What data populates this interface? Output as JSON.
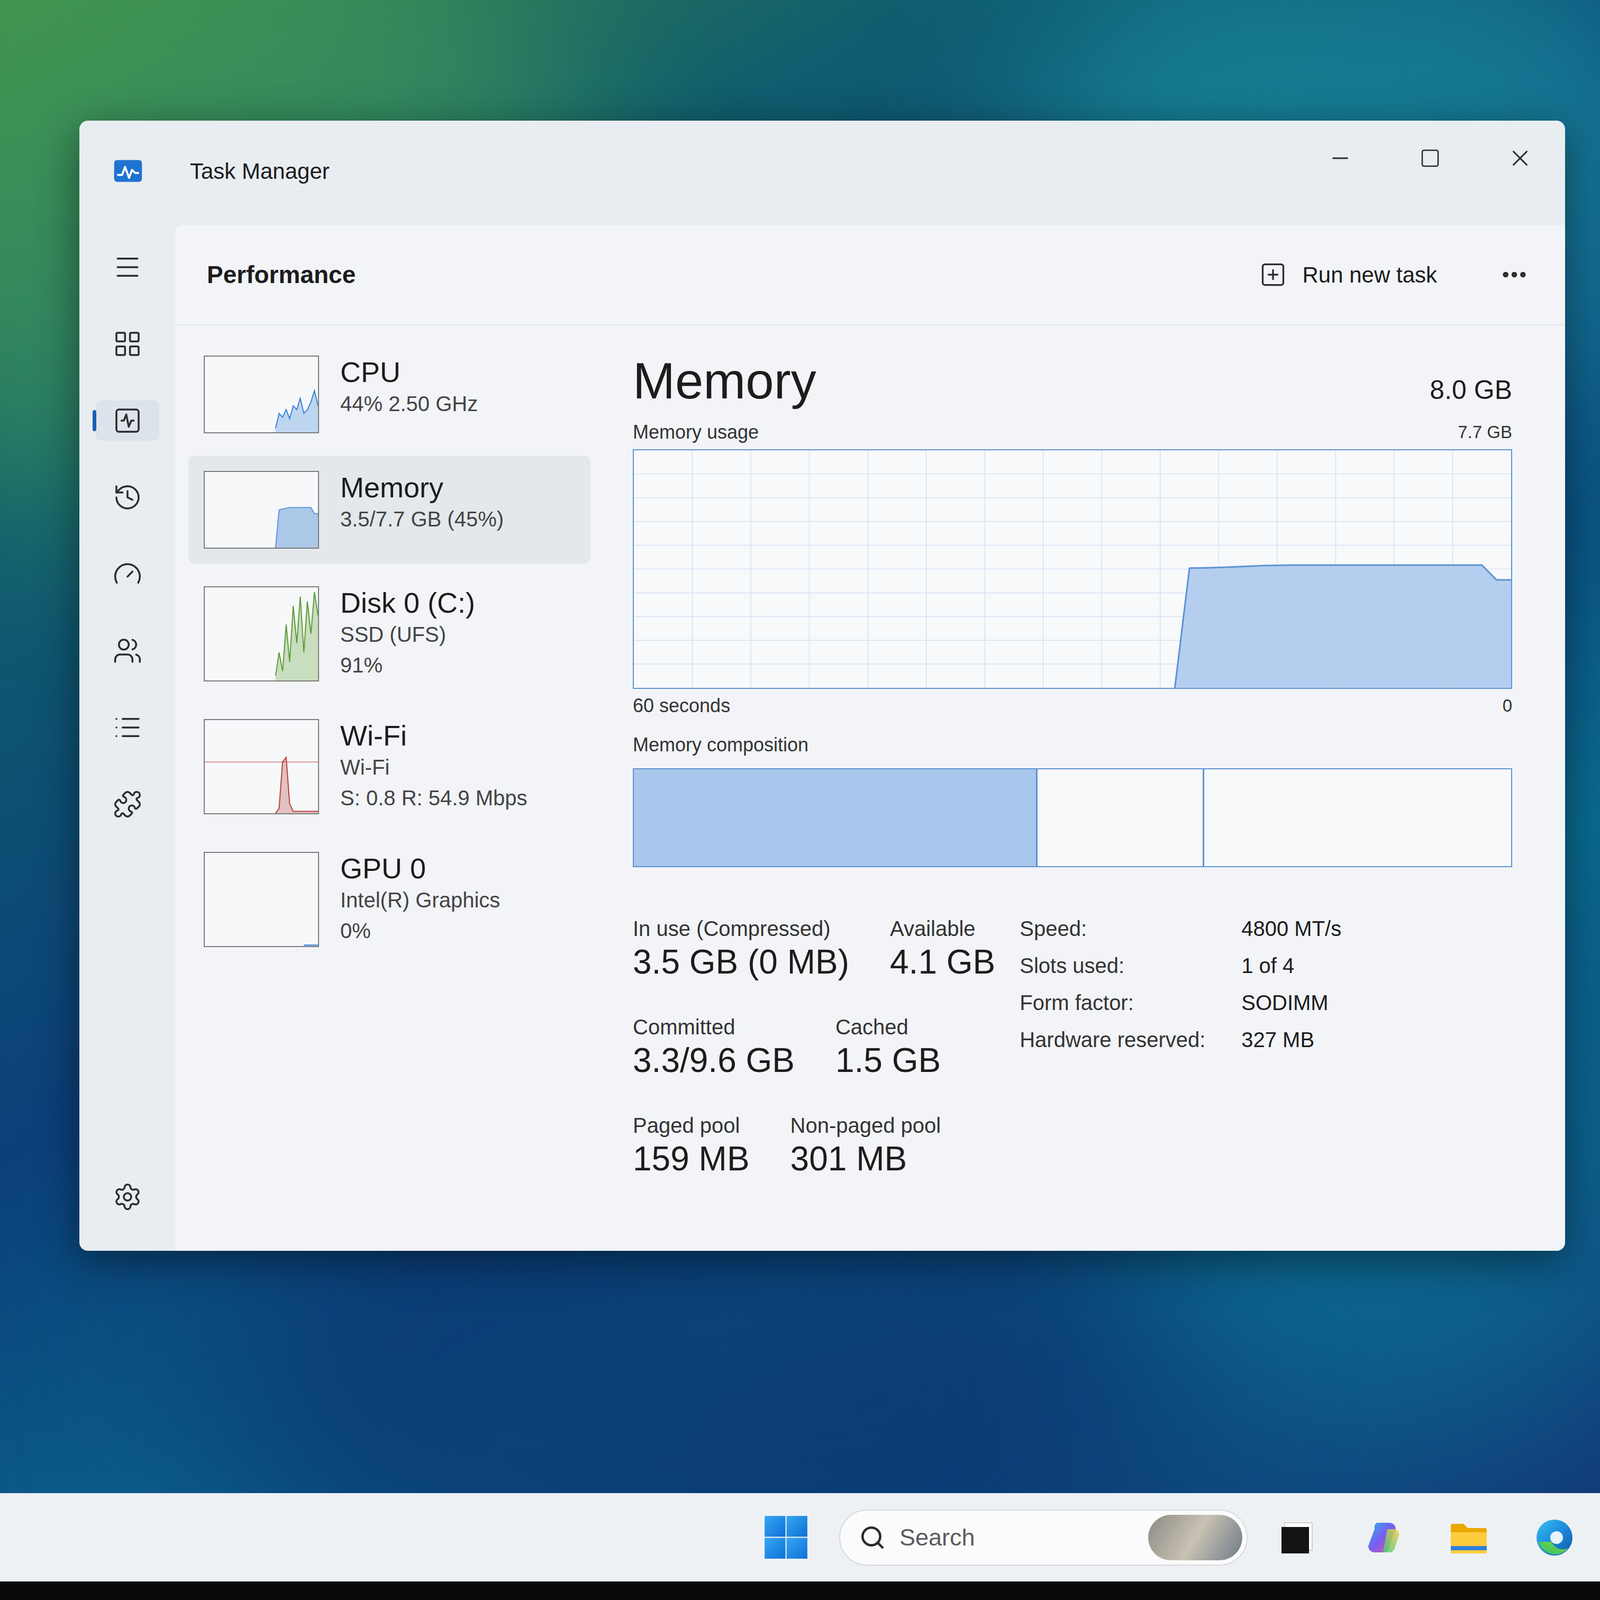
{
  "window": {
    "title": "Task Manager"
  },
  "nav": [
    {
      "selected": false
    },
    {
      "selected": false
    },
    {
      "selected": true
    },
    {
      "selected": false
    },
    {
      "selected": false
    },
    {
      "selected": false
    },
    {
      "selected": false
    },
    {
      "selected": false
    },
    {
      "selected": false
    }
  ],
  "header": {
    "title": "Performance",
    "action": "Run new task"
  },
  "resources": [
    {
      "name": "CPU",
      "details": [
        "44% 2.50 GHz"
      ],
      "selected": false,
      "kind": "cpu",
      "color": "#3d84d6",
      "slots": 32,
      "values": [
        0.05,
        0.25,
        0.2,
        0.3,
        0.18,
        0.35,
        0.3,
        0.45,
        0.25,
        0.3,
        0.4,
        0.55,
        0.35
      ]
    },
    {
      "name": "Memory",
      "details": [
        "3.5/7.7 GB (45%)"
      ],
      "selected": true,
      "kind": "memory",
      "color": "#5f98d8",
      "slots": 32,
      "values": [
        0,
        0.5,
        0.51,
        0.52,
        0.53,
        0.53,
        0.53,
        0.53,
        0.53,
        0.53,
        0.53,
        0.45,
        0.45
      ]
    },
    {
      "name": "Disk 0 (C:)",
      "details": [
        "SSD (UFS)",
        "91%"
      ],
      "selected": false,
      "kind": "disk",
      "color": "#5f9e38",
      "slots": 32,
      "values": [
        0.05,
        0.3,
        0.1,
        0.6,
        0.2,
        0.8,
        0.4,
        0.9,
        0.3,
        0.85,
        0.5,
        0.95,
        0.7
      ]
    },
    {
      "name": "Wi-Fi",
      "details": [
        "Wi-Fi",
        "S: 0.8 R: 54.9 Mbps"
      ],
      "selected": false,
      "kind": "network",
      "color": "#b8413f",
      "slots": 32,
      "values": [
        0,
        0.05,
        0.55,
        0.6,
        0.1,
        0.02,
        0.02,
        0.02,
        0.02,
        0.02,
        0.02,
        0.02,
        0.02
      ]
    },
    {
      "name": "GPU 0",
      "details": [
        "Intel(R) Graphics",
        "0%"
      ],
      "selected": false,
      "kind": "gpu",
      "color": "#3d84d6",
      "slots": 32,
      "values": [
        0.01,
        0.01,
        0.01,
        0.01,
        0.01
      ]
    }
  ],
  "detail": {
    "title": "Memory",
    "total": "8.0 GB",
    "usage_label": "Memory usage",
    "usage_max": "7.7 GB",
    "chart": {
      "axis_max": 7.7,
      "slots": 60,
      "values": [
        0,
        3.88,
        3.89,
        3.9,
        3.92,
        3.94,
        3.96,
        3.97,
        3.98,
        3.98,
        3.98,
        3.98,
        3.98,
        3.98,
        3.98,
        3.98,
        3.98,
        3.98,
        3.98,
        3.98,
        3.98,
        3.98,
        3.5,
        3.5
      ]
    },
    "time_label": "60 seconds",
    "time_end": "0",
    "composition_label": "Memory composition",
    "composition": [
      {
        "level": 0.46,
        "filled": true
      },
      {
        "level": 0.19,
        "filled": false
      },
      {
        "level": 0.35,
        "filled": false
      }
    ],
    "stats": [
      [
        {
          "label": "In use (Compressed)",
          "value": "3.5 GB (0 MB)"
        },
        {
          "label": "Available",
          "value": "4.1 GB"
        }
      ],
      [
        {
          "label": "Committed",
          "value": "3.3/9.6 GB"
        },
        {
          "label": "Cached",
          "value": "1.5 GB"
        }
      ],
      [
        {
          "label": "Paged pool",
          "value": "159 MB"
        },
        {
          "label": "Non-paged pool",
          "value": "301 MB"
        }
      ]
    ],
    "specs": [
      {
        "label": "Speed:",
        "value": "4800 MT/s"
      },
      {
        "label": "Slots used:",
        "value": "1 of 4"
      },
      {
        "label": "Form factor:",
        "value": "SODIMM"
      },
      {
        "label": "Hardware reserved:",
        "value": "327 MB"
      }
    ]
  },
  "taskbar": {
    "search": {
      "placeholder": "Search"
    }
  }
}
